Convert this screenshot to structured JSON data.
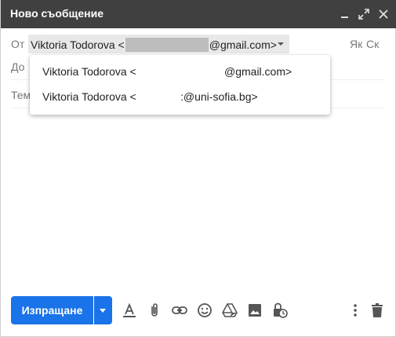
{
  "window": {
    "title": "Ново съобщение",
    "controls": [
      "minimize-icon",
      "expand-icon",
      "close-icon"
    ]
  },
  "fields": {
    "from_label": "От",
    "to_label": "До",
    "subject_label": "Тем",
    "from_value_prefix": "Viktoria Todorova <",
    "from_value_suffix": "@gmail.com>",
    "cc_label": "Як",
    "bcc_label": "Ск"
  },
  "from_dropdown": {
    "options": [
      {
        "prefix": "Viktoria Todorova <",
        "suffix": "@gmail.com>"
      },
      {
        "prefix": "Viktoria Todorova <",
        "suffix": ":@uni-sofia.bg>"
      }
    ]
  },
  "toolbar": {
    "send_label": "Изпращане",
    "icons": [
      "text-format-icon",
      "attach-icon",
      "link-icon",
      "emoji-icon",
      "drive-icon",
      "image-icon",
      "confidential-mode-icon",
      "more-options-icon",
      "trash-icon"
    ]
  },
  "colors": {
    "titlebar": "#404040",
    "send_button": "#1a73e8",
    "redaction": "#bdbdbd"
  }
}
